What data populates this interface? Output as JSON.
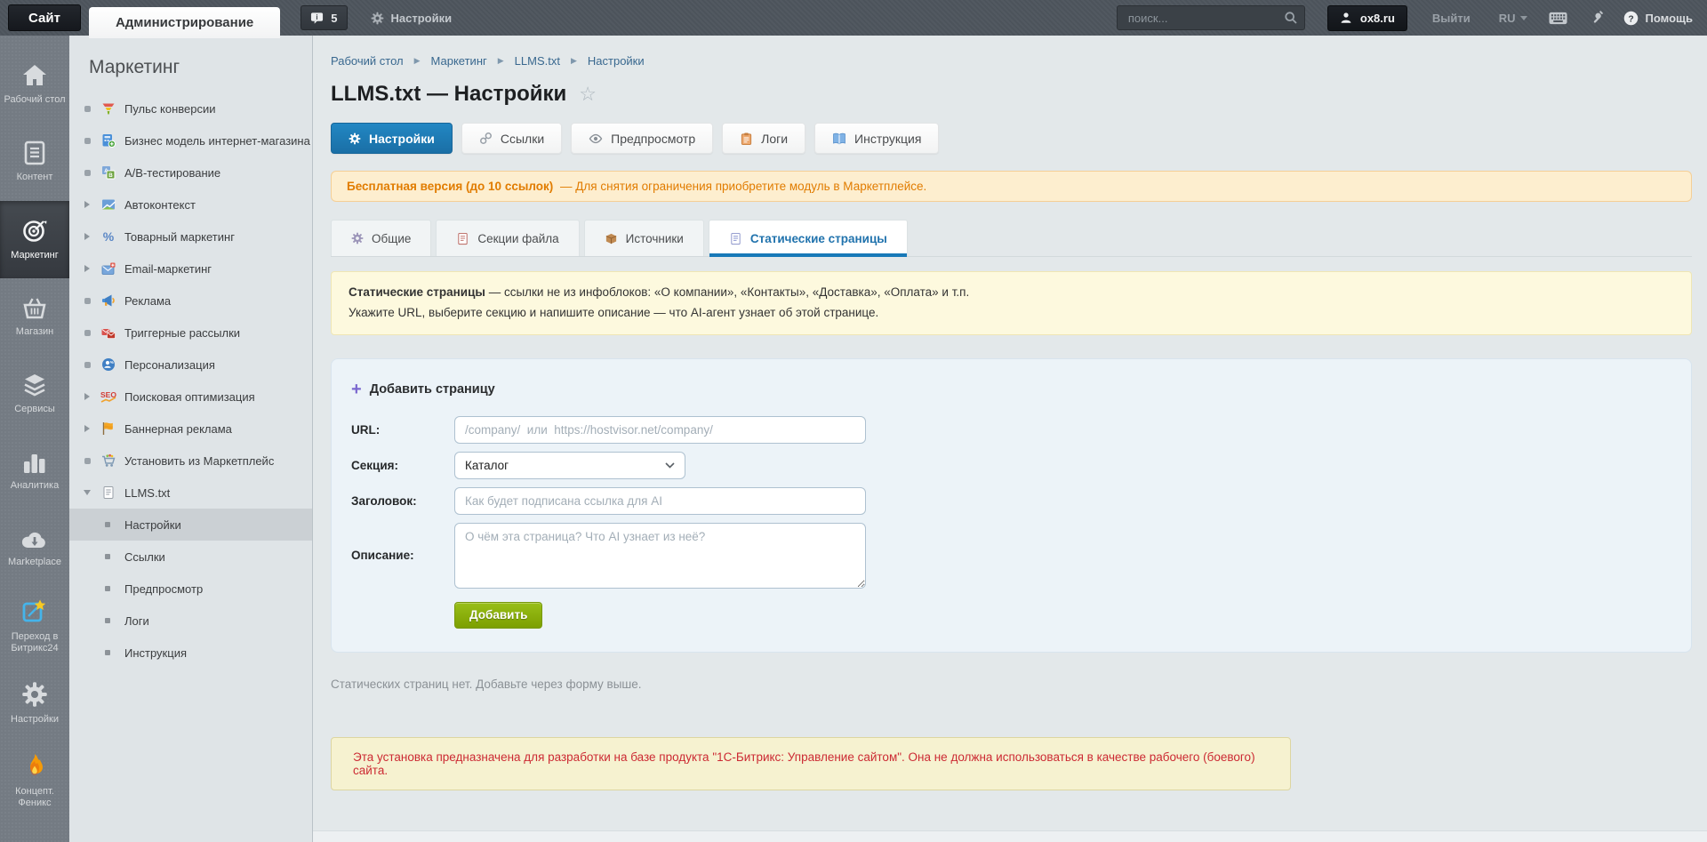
{
  "topbar": {
    "site_tab": "Сайт",
    "admin_tab": "Администрирование",
    "notifications_count": "5",
    "settings_label": "Настройки",
    "search_placeholder": "поиск...",
    "user_label": "ox8.ru",
    "logout_label": "Выйти",
    "language": "RU",
    "help_label": "Помощь"
  },
  "rail": {
    "items": [
      {
        "label": "Рабочий стол",
        "icon": "home-icon",
        "active": false
      },
      {
        "label": "Контент",
        "icon": "content-icon",
        "active": false
      },
      {
        "label": "Маркетинг",
        "icon": "marketing-target-icon",
        "active": true
      },
      {
        "label": "Магазин",
        "icon": "shop-basket-icon",
        "active": false
      },
      {
        "label": "Сервисы",
        "icon": "services-layers-icon",
        "active": false
      },
      {
        "label": "Аналитика",
        "icon": "analytics-bars-icon",
        "active": false
      },
      {
        "label": "Marketplace",
        "icon": "marketplace-cloud-icon",
        "active": false
      },
      {
        "label": "Переход в Битрикс24",
        "icon": "bitrix24-icon",
        "active": false
      },
      {
        "label": "Настройки",
        "icon": "gear-icon",
        "active": false
      },
      {
        "label": "Концепт. Феникс",
        "icon": "flame-icon",
        "active": false
      }
    ]
  },
  "menu": {
    "title": "Маркетинг",
    "items": [
      {
        "label": "Пульс конверсии",
        "icon": "funnel-icon",
        "marker": "dot"
      },
      {
        "label": "Бизнес модель интернет-магазина",
        "icon": "business-model-icon",
        "marker": "dot"
      },
      {
        "label": "A/B-тестирование",
        "icon": "ab-test-icon",
        "marker": "dot"
      },
      {
        "label": "Автоконтекст",
        "icon": "autocontext-icon",
        "marker": "arrow"
      },
      {
        "label": "Товарный маркетинг",
        "icon": "percent-icon",
        "marker": "arrow"
      },
      {
        "label": "Email-маркетинг",
        "icon": "email-icon",
        "marker": "arrow"
      },
      {
        "label": "Реклама",
        "icon": "megaphone-icon",
        "marker": "dot"
      },
      {
        "label": "Триггерные рассылки",
        "icon": "mailings-icon",
        "marker": "dot"
      },
      {
        "label": "Персонализация",
        "icon": "personalization-icon",
        "marker": "dot"
      },
      {
        "label": "Поисковая оптимизация",
        "icon": "seo-icon",
        "marker": "arrow"
      },
      {
        "label": "Баннерная реклама",
        "icon": "banner-flag-icon",
        "marker": "arrow"
      },
      {
        "label": "Установить из Маркетплейс",
        "icon": "cart-icon",
        "marker": "dot"
      },
      {
        "label": "LLMS.txt",
        "icon": "document-icon",
        "marker": "arrow-down"
      }
    ],
    "llms_children": [
      {
        "label": "Настройки",
        "selected": true
      },
      {
        "label": "Ссылки",
        "selected": false
      },
      {
        "label": "Предпросмотр",
        "selected": false
      },
      {
        "label": "Логи",
        "selected": false
      },
      {
        "label": "Инструкция",
        "selected": false
      }
    ]
  },
  "breadcrumb": {
    "items": [
      "Рабочий стол",
      "Маркетинг",
      "LLMS.txt",
      "Настройки"
    ]
  },
  "page": {
    "title": "LLMS.txt — Настройки"
  },
  "action_buttons": [
    {
      "label": "Настройки",
      "icon": "gear-icon",
      "active": true
    },
    {
      "label": "Ссылки",
      "icon": "link-icon",
      "active": false
    },
    {
      "label": "Предпросмотр",
      "icon": "eye-icon",
      "active": false
    },
    {
      "label": "Логи",
      "icon": "clipboard-icon",
      "active": false
    },
    {
      "label": "Инструкция",
      "icon": "book-icon",
      "active": false
    }
  ],
  "license_banner": {
    "title": "Бесплатная версия (до 10 ссылок)",
    "text": "— Для снятия ограничения приобретите модуль в Маркетплейсе."
  },
  "tabs": [
    {
      "label": "Общие",
      "icon": "gear-icon",
      "active": false
    },
    {
      "label": "Секции файла",
      "icon": "file-sections-icon",
      "active": false
    },
    {
      "label": "Источники",
      "icon": "box-icon",
      "active": false
    },
    {
      "label": "Статические страницы",
      "icon": "static-pages-icon",
      "active": true
    }
  ],
  "info_box": {
    "title": "Статические страницы",
    "line1_rest": " — ссылки не из инфоблоков: «О компании», «Контакты», «Доставка», «Оплата» и т.п.",
    "line2": "Укажите URL, выберите секцию и напишите описание — что AI-агент узнает об этой странице."
  },
  "form": {
    "plus": "+",
    "legend": "Добавить страницу",
    "url_label": "URL:",
    "url_placeholder": "/company/  или  https://hostvisor.net/company/",
    "section_label": "Секция:",
    "section_value": "Каталог",
    "title_label": "Заголовок:",
    "title_placeholder": "Как будет подписана ссылка для AI",
    "description_label": "Описание:",
    "description_placeholder": "О чём эта страница? Что AI узнает из неё?",
    "submit_label": "Добавить"
  },
  "empty_state": "Статических страниц нет. Добавьте через форму выше.",
  "dev_banner": "Эта установка предназначена для разработки на базе продукта \"1С-Битрикс: Управление сайтом\". Она не должна использоваться в качестве рабочего (боевого) сайта.",
  "colors": {
    "accent_blue": "#1879b8",
    "button_green": "#7c9f00",
    "warning_orange": "#e17c00",
    "error_red": "#cc2a33"
  }
}
